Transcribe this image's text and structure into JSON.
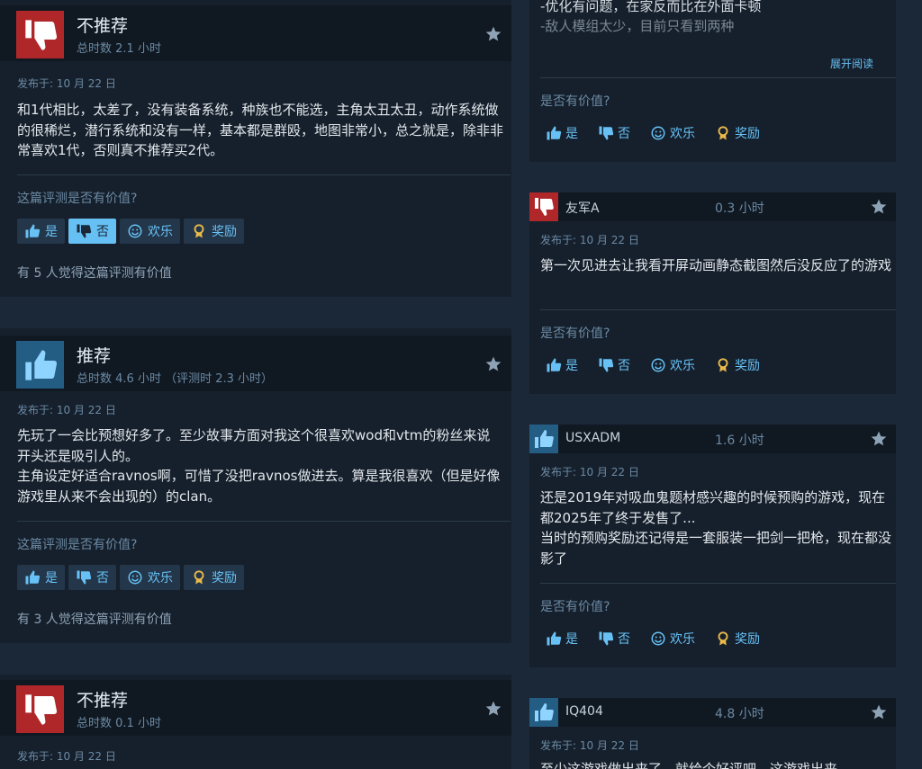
{
  "labels": {
    "helpful_question": "这篇评测是否有价值?",
    "helpful_question_short": "是否有价值?",
    "yes": "是",
    "no": "否",
    "funny": "欢乐",
    "award": "奖励",
    "expand": "展开阅读"
  },
  "left_reviews": [
    {
      "verdict": "不推荐",
      "hours": "总时数 2.1 小时",
      "posted": "发布于: 10 月 22 日",
      "text": "和1代相比，太差了，没有装备系统，种族也不能选，主角太丑太丑，动作系统做的很稀烂，潜行系统和没有一样，基本都是群殴，地图非常小，总之就是，除非非常喜欢1代，否则真不推荐买2代。",
      "helpful_count": "有 5 人觉得这篇评测有价值"
    },
    {
      "verdict": "推荐",
      "hours": "总时数 4.6 小时 （评测时 2.3 小时）",
      "posted": "发布于: 10 月 22 日",
      "text_lines": [
        "先玩了一会比预想好多了。至少故事方面对我这个很喜欢wod和vtm的粉丝来说开头还是吸引人的。",
        "主角设定好适合ravnos啊，可惜了没把ravnos做进去。算是我很喜欢（但是好像游戏里从来不会出现的）的clan。"
      ],
      "helpful_count": "有 3 人觉得这篇评测有价值"
    },
    {
      "verdict": "不推荐",
      "hours": "总时数 0.1 小时",
      "posted": "发布于: 10 月 22 日"
    }
  ],
  "right_reviews": [
    {
      "partial_lines": [
        "-优化有问题，在家反而比在外面卡顿",
        "-敌人模组太少，目前只看到两种"
      ]
    },
    {
      "name": "友军A",
      "hours": "0.3 小时",
      "posted": "发布于: 10 月 22 日",
      "text": "第一次见进去让我看开屏动画静态截图然后没反应了的游戏"
    },
    {
      "name": "USXADM",
      "hours": "1.6 小时",
      "posted": "发布于: 10 月 22 日",
      "text_lines": [
        "还是2019年对吸血鬼题材感兴趣的时候预购的游戏，现在都2025年了终于发售了...",
        "当时的预购奖励还记得是一套服装一把剑一把枪，现在都没影了"
      ]
    },
    {
      "name": "IQ404",
      "hours": "4.8 小时",
      "posted": "发布于: 10 月 22 日",
      "text": "至少这游戏做出来了，就给个好评吧，这游戏出来"
    }
  ],
  "colors": {
    "accent": "#67c1f5",
    "negative": "#b0272a",
    "positive": "#245d84",
    "background": "#1b2838"
  },
  "icons": [
    "thumbs-down-icon",
    "thumbs-up-icon",
    "award-star-icon",
    "smile-icon",
    "award-medal-icon"
  ]
}
